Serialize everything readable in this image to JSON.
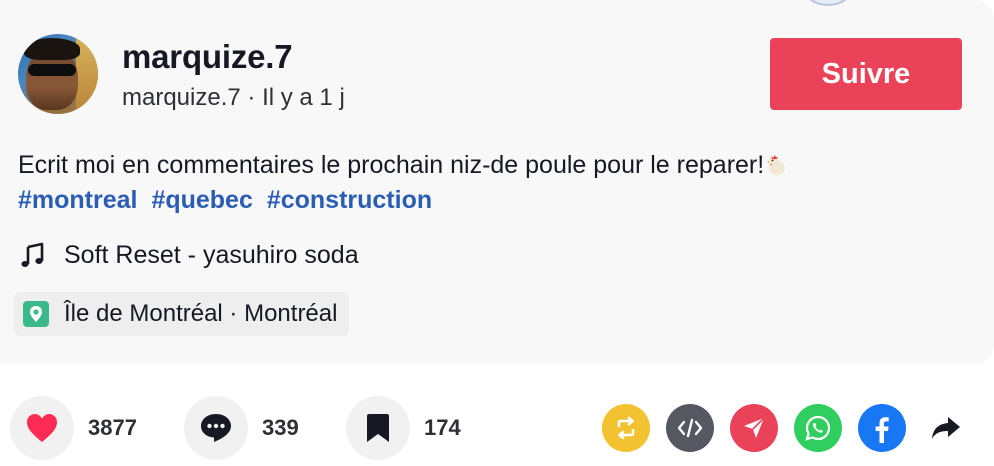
{
  "author": {
    "username": "marquize.7",
    "handle": "marquize.7",
    "separator": "·",
    "time_ago": "Il y a 1 j",
    "subline": "marquize.7 · Il y a 1 j"
  },
  "follow_button": {
    "label": "Suivre",
    "color": "#ea4359"
  },
  "description": {
    "text": "Ecrit moi en commentaires le prochain niz-de poule pour le reparer!",
    "emoji": "chicken-emoji",
    "hashtags": [
      "#montreal",
      "#quebec",
      "#construction"
    ],
    "hashtag_color": "#2b5db4"
  },
  "music": {
    "icon": "music-note-icon",
    "label": "Soft Reset - yasuhiro soda"
  },
  "location": {
    "icon": "location-pin-icon",
    "label": "Île de Montréal · Montréal",
    "icon_color": "#3bb98a"
  },
  "stats": {
    "likes": {
      "icon": "heart-icon",
      "count": "3877",
      "color": "#fe2c55"
    },
    "comments": {
      "icon": "comment-icon",
      "count": "339"
    },
    "saves": {
      "icon": "bookmark-icon",
      "count": "174"
    }
  },
  "share": [
    {
      "name": "repost-icon",
      "color": "#f2c230"
    },
    {
      "name": "embed-code-icon",
      "color": "#555861"
    },
    {
      "name": "send-to-friends-icon",
      "color": "#ea4359"
    },
    {
      "name": "whatsapp-icon",
      "color": "#2fce5e"
    },
    {
      "name": "facebook-icon",
      "color": "#1877f2"
    },
    {
      "name": "share-arrow-icon",
      "color": "#161823"
    }
  ]
}
